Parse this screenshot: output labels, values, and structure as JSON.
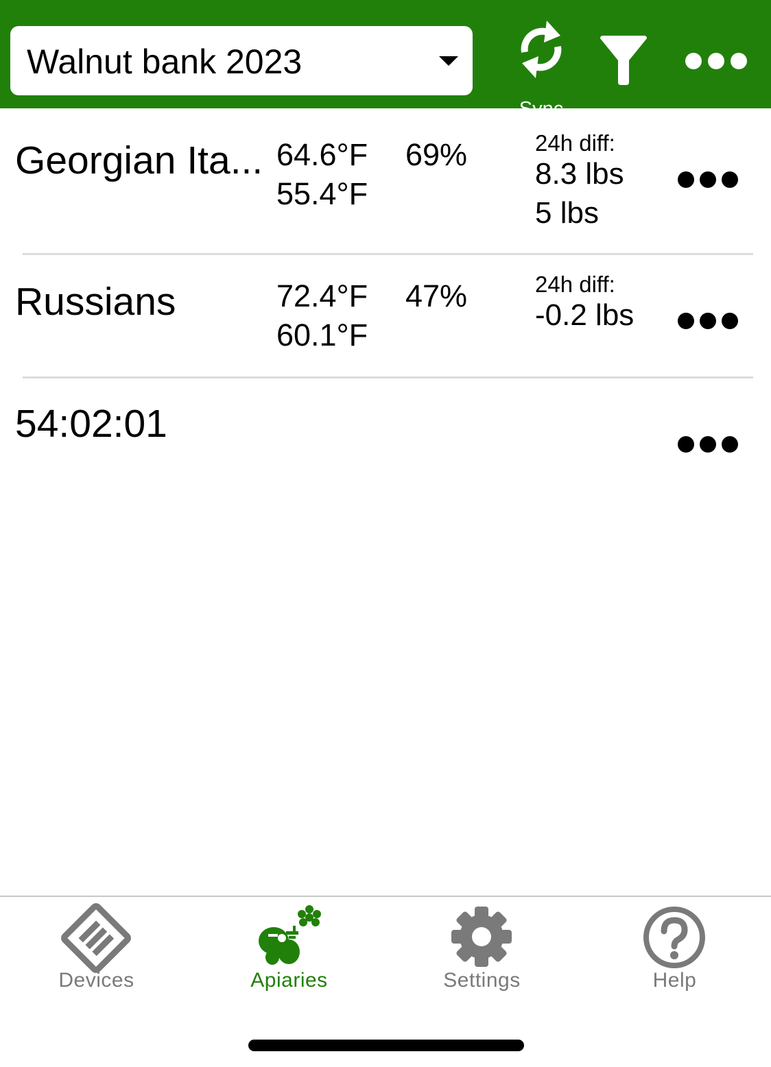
{
  "header": {
    "apiary_name": "Walnut bank 2023",
    "sync_label": "Sync",
    "filter_icon": "filter-icon",
    "more_icon": "more-horizontal-icon"
  },
  "hives": [
    {
      "name": "Georgian Ita...",
      "temp_high": "64.6°F",
      "temp_low": "55.4°F",
      "humidity": "69%",
      "diff_label": "24h diff:",
      "weight_diff": "8.3 lbs",
      "weight": "5 lbs"
    },
    {
      "name": "Russians",
      "temp_high": "72.4°F",
      "temp_low": "60.1°F",
      "humidity": "47%",
      "diff_label": "24h diff:",
      "weight_diff": "-0.2 lbs"
    },
    {
      "name": "54:02:01"
    }
  ],
  "tabs": [
    {
      "label": "Devices",
      "icon": "devices-icon",
      "active": false
    },
    {
      "label": "Apiaries",
      "icon": "apiary-icon",
      "active": true
    },
    {
      "label": "Settings",
      "icon": "gear-icon",
      "active": false
    },
    {
      "label": "Help",
      "icon": "help-icon",
      "active": false
    }
  ],
  "colors": {
    "brand_green": "#21800a",
    "inactive_tab": "#7a7a7a",
    "active_tab": "#21800a"
  }
}
